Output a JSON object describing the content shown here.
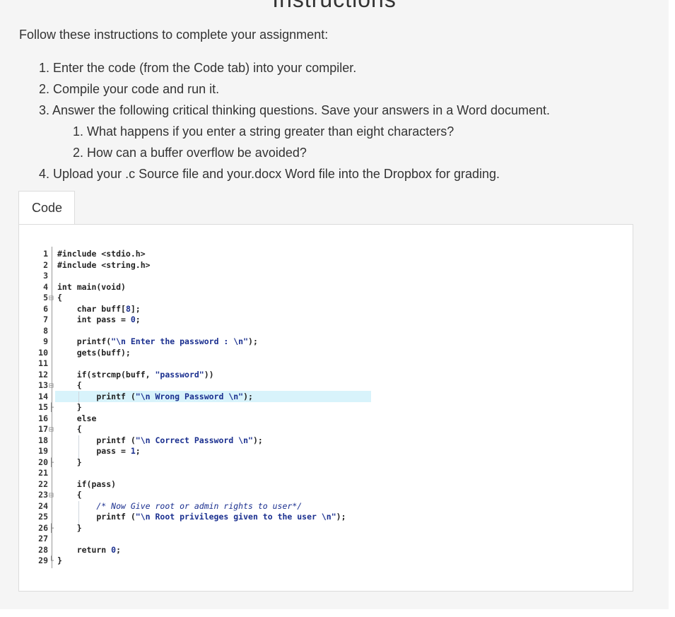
{
  "heading": "Instructions",
  "intro": "Follow these instructions to complete your assignment:",
  "steps": [
    "1. Enter the code (from the Code tab) into your compiler.",
    "2. Compile your code and run it.",
    "3. Answer the following critical thinking questions. Save your answers in a Word document.",
    "1. What happens if you enter a string greater than eight characters?",
    "2. How can a buffer overflow be avoided?",
    "4. Upload your .c Source file and your.docx Word file into the Dropbox for grading."
  ],
  "tab_label": "Code",
  "code": {
    "line_numbers": [
      "1",
      "2",
      "3",
      "4",
      "5",
      "6",
      "7",
      "8",
      "9",
      "10",
      "11",
      "12",
      "13",
      "14",
      "15",
      "16",
      "17",
      "18",
      "19",
      "20",
      "21",
      "22",
      "23",
      "24",
      "25",
      "26",
      "27",
      "28",
      "29"
    ],
    "lines": [
      "#include <stdio.h>",
      "#include <string.h>",
      "",
      "int main(void)",
      "{",
      "    char buff[8];",
      "    int pass = 0;",
      "",
      "    printf(\"\\n Enter the password : \\n\");",
      "    gets(buff);",
      "",
      "    if(strcmp(buff, \"password\"))",
      "    {",
      "        printf (\"\\n Wrong Password \\n\");",
      "    }",
      "    else",
      "    {",
      "        printf (\"\\n Correct Password \\n\");",
      "        pass = 1;",
      "    }",
      "",
      "    if(pass)",
      "    {",
      "        /* Now Give root or admin rights to user*/",
      "        printf (\"\\n Root privileges given to the user \\n\");",
      "    }",
      "",
      "    return 0;",
      "}"
    ],
    "highlighted_line": 14
  }
}
